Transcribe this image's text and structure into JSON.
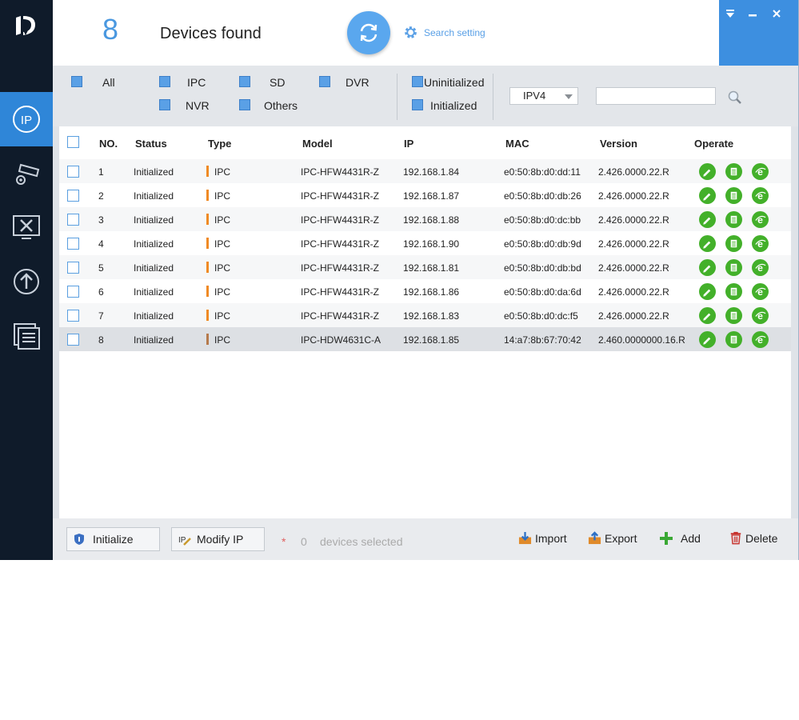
{
  "header": {
    "count": "8",
    "found_label": "Devices found",
    "search_setting_label": "Search setting"
  },
  "filters": {
    "all": "All",
    "ipc": "IPC",
    "sd": "SD",
    "dvr": "DVR",
    "nvr": "NVR",
    "others": "Others",
    "uninitialized": "Uninitialized",
    "initialized": "Initialized",
    "ip_version": "IPV4",
    "search_value": ""
  },
  "table": {
    "columns": [
      "NO.",
      "Status",
      "Type",
      "Model",
      "IP",
      "MAC",
      "Version",
      "Operate"
    ],
    "rows": [
      {
        "no": "1",
        "status": "Initialized",
        "type": "IPC",
        "model": "IPC-HFW4431R-Z",
        "ip": "192.168.1.84",
        "mac": "e0:50:8b:d0:dd:11",
        "version": "2.426.0000.22.R"
      },
      {
        "no": "2",
        "status": "Initialized",
        "type": "IPC",
        "model": "IPC-HFW4431R-Z",
        "ip": "192.168.1.87",
        "mac": "e0:50:8b:d0:db:26",
        "version": "2.426.0000.22.R"
      },
      {
        "no": "3",
        "status": "Initialized",
        "type": "IPC",
        "model": "IPC-HFW4431R-Z",
        "ip": "192.168.1.88",
        "mac": "e0:50:8b:d0:dc:bb",
        "version": "2.426.0000.22.R"
      },
      {
        "no": "4",
        "status": "Initialized",
        "type": "IPC",
        "model": "IPC-HFW4431R-Z",
        "ip": "192.168.1.90",
        "mac": "e0:50:8b:d0:db:9d",
        "version": "2.426.0000.22.R"
      },
      {
        "no": "5",
        "status": "Initialized",
        "type": "IPC",
        "model": "IPC-HFW4431R-Z",
        "ip": "192.168.1.81",
        "mac": "e0:50:8b:d0:db:bd",
        "version": "2.426.0000.22.R"
      },
      {
        "no": "6",
        "status": "Initialized",
        "type": "IPC",
        "model": "IPC-HFW4431R-Z",
        "ip": "192.168.1.86",
        "mac": "e0:50:8b:d0:da:6d",
        "version": "2.426.0000.22.R"
      },
      {
        "no": "7",
        "status": "Initialized",
        "type": "IPC",
        "model": "IPC-HFW4431R-Z",
        "ip": "192.168.1.83",
        "mac": "e0:50:8b:d0:dc:f5",
        "version": "2.426.0000.22.R"
      },
      {
        "no": "8",
        "status": "Initialized",
        "type": "IPC",
        "model": "IPC-HDW4631C-A",
        "ip": "192.168.1.85",
        "mac": "14:a7:8b:67:70:42",
        "version": "2.460.0000000.16.R"
      }
    ]
  },
  "bottom": {
    "initialize_label": "Initialize",
    "modify_ip_label": "Modify IP",
    "selected_star": "*",
    "selected_count": "0",
    "selected_label": "devices selected",
    "import_label": "Import",
    "export_label": "Export",
    "add_label": "Add",
    "delete_label": "Delete"
  },
  "colors": {
    "accent": "#3d8fe0",
    "sidebar": "#0f1b2a",
    "operate_green": "#43b02a",
    "type_orange": "#f08a24"
  },
  "icons": [
    "app-logo-icon",
    "ip-icon",
    "camera-settings-icon",
    "tools-icon",
    "upgrade-icon",
    "document-icon",
    "refresh-icon",
    "gear-icon",
    "search-icon",
    "edit-icon",
    "web-page-icon",
    "browser-icon",
    "shield-icon",
    "import-icon",
    "export-icon",
    "add-icon",
    "delete-icon"
  ]
}
